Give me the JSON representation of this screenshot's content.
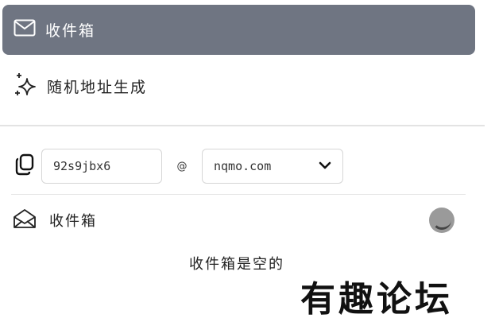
{
  "nav": {
    "inbox_label": "收件箱",
    "generate_label": "随机地址生成"
  },
  "address": {
    "username": "92s9jbx6",
    "at": "@",
    "domain": "nqmo.com"
  },
  "inbox": {
    "title": "收件箱",
    "empty_text": "收件箱是空的"
  },
  "watermark": "有趣论坛",
  "colors": {
    "active_nav_bg": "#6f7582",
    "border": "#d6d6d6"
  }
}
